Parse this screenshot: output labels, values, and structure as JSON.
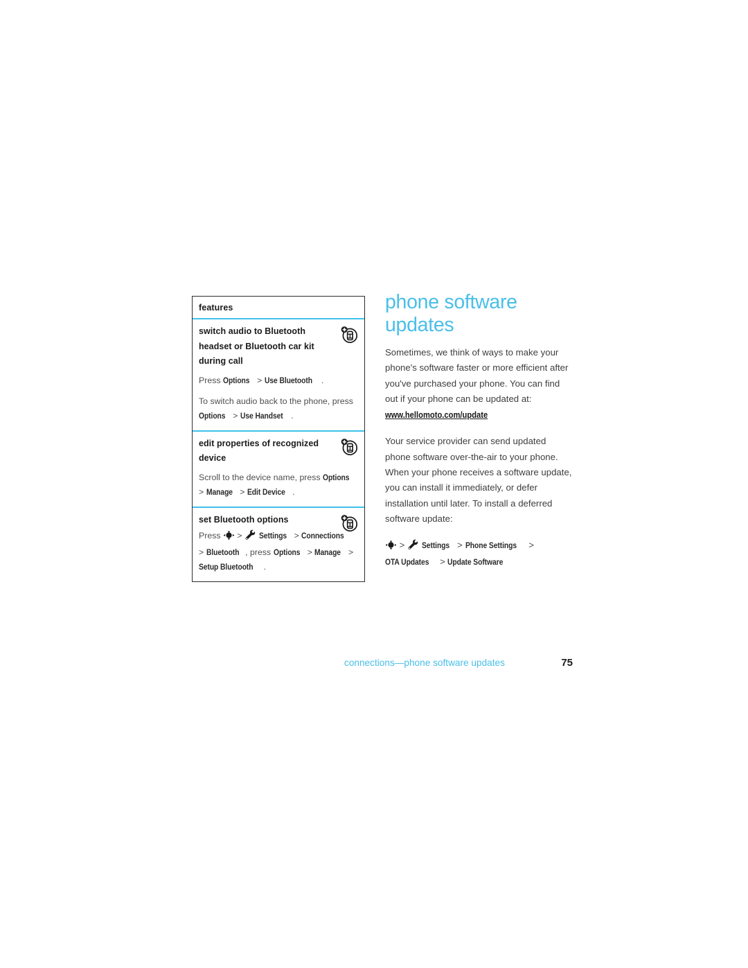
{
  "page": {
    "number": "75",
    "footer_breadcrumb": "connections—phone software updates"
  },
  "colors": {
    "accent_cyan": "#49bfe8",
    "divider_cyan": "#3fc1ea",
    "table_border": "#2b2b2b",
    "body_text": "#3d3d3d"
  },
  "features_table": {
    "header": "features",
    "rows": [
      {
        "title": "switch audio to Bluetooth headset or Bluetooth car kit during call",
        "icon": "bluetooth-device-add-icon",
        "paragraphs": [
          {
            "segments": [
              {
                "text": "Press ",
                "style": "plain"
              },
              {
                "text": "Options",
                "style": "cond"
              },
              {
                "text": " > ",
                "style": "gt"
              },
              {
                "text": "Use Bluetooth",
                "style": "cond"
              },
              {
                "text": ".",
                "style": "plain"
              }
            ]
          },
          {
            "segments": [
              {
                "text": "To switch audio back to the phone, press ",
                "style": "plain"
              },
              {
                "text": "Options",
                "style": "cond"
              },
              {
                "text": " > ",
                "style": "gt"
              },
              {
                "text": "Use Handset",
                "style": "cond"
              },
              {
                "text": ".",
                "style": "plain"
              }
            ]
          }
        ]
      },
      {
        "title": "edit properties of recognized device",
        "icon": "bluetooth-device-add-icon",
        "paragraphs": [
          {
            "segments": [
              {
                "text": "Scroll to the device name, press ",
                "style": "plain"
              },
              {
                "text": "Options",
                "style": "cond"
              },
              {
                "text": " > ",
                "style": "gt"
              },
              {
                "text": "Manage",
                "style": "cond"
              },
              {
                "text": " > ",
                "style": "gt"
              },
              {
                "text": "Edit Device",
                "style": "cond"
              },
              {
                "text": ".",
                "style": "plain"
              }
            ]
          }
        ]
      },
      {
        "title": "set Bluetooth options",
        "icon": "bluetooth-device-add-icon",
        "paragraphs": [
          {
            "segments": [
              {
                "text": "Press ",
                "style": "plain"
              },
              {
                "text": "center-key-icon",
                "style": "icon"
              },
              {
                "text": " > ",
                "style": "gt"
              },
              {
                "text": "settings-gear-icon",
                "style": "icon"
              },
              {
                "text": " ",
                "style": "plain"
              },
              {
                "text": "Settings",
                "style": "cond"
              },
              {
                "text": " > ",
                "style": "gt"
              },
              {
                "text": "Connections",
                "style": "cond"
              },
              {
                "text": " > ",
                "style": "gt"
              },
              {
                "text": "Bluetooth",
                "style": "cond"
              },
              {
                "text": ", press ",
                "style": "plain"
              },
              {
                "text": "Options",
                "style": "cond"
              },
              {
                "text": " > ",
                "style": "gt"
              },
              {
                "text": "Manage",
                "style": "cond"
              },
              {
                "text": " > ",
                "style": "gt"
              },
              {
                "text": "Setup Bluetooth",
                "style": "cond"
              },
              {
                "text": ".",
                "style": "plain"
              }
            ]
          }
        ]
      }
    ]
  },
  "article": {
    "heading": "phone software updates",
    "paragraph_1": "Sometimes, we think of ways to make your phone's software faster or more efficient after you've purchased your phone. You can find out if your phone can be updated at:",
    "link": "www.hellomoto.com/update",
    "paragraph_2": "Your service provider can send updated phone software over-the-air to your phone. When your phone receives a software update, you can install it immediately, or defer installation until later. To install a deferred software update:",
    "menu_path": {
      "segments": [
        {
          "text": "center-key-icon",
          "style": "icon"
        },
        {
          "text": " > ",
          "style": "gt"
        },
        {
          "text": "settings-gear-icon",
          "style": "icon"
        },
        {
          "text": " ",
          "style": "plain"
        },
        {
          "text": "Settings",
          "style": "cond"
        },
        {
          "text": " > ",
          "style": "gt"
        },
        {
          "text": "Phone Settings",
          "style": "cond"
        },
        {
          "text": " > ",
          "style": "gt"
        },
        {
          "text": "OTA Updates",
          "style": "cond"
        },
        {
          "text": " > ",
          "style": "gt"
        },
        {
          "text": "Update Software",
          "style": "cond"
        }
      ]
    }
  }
}
